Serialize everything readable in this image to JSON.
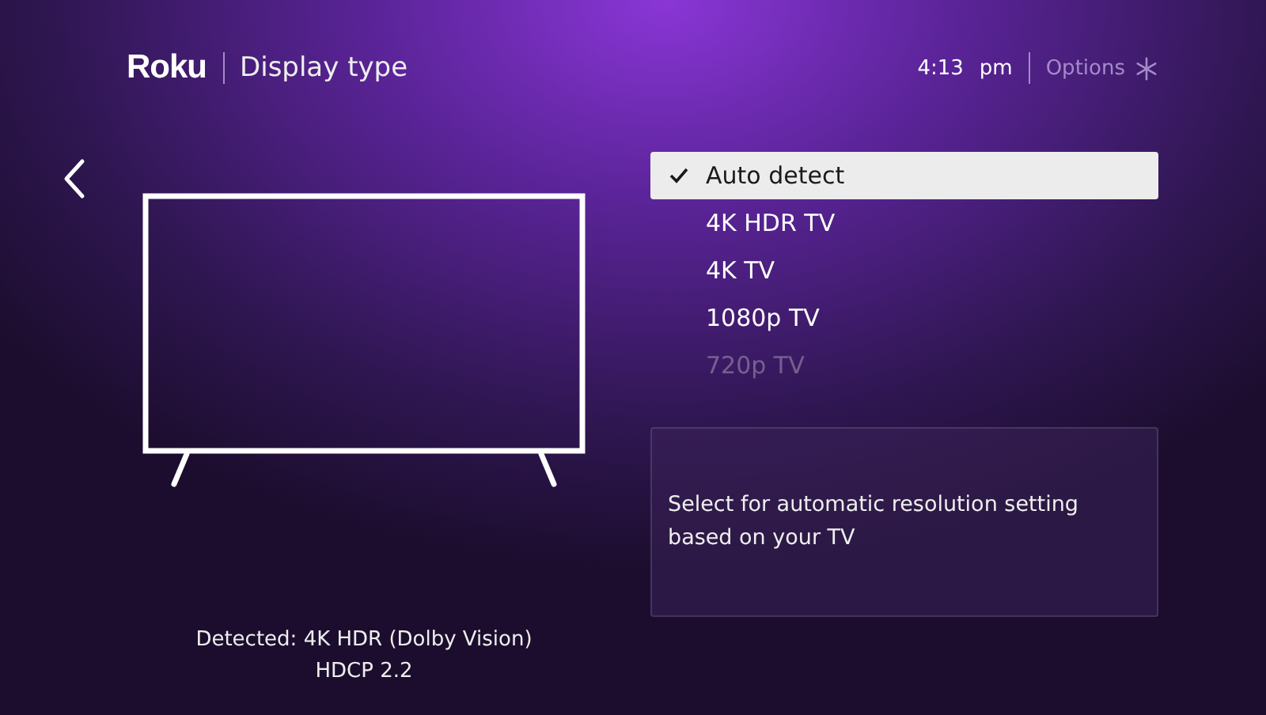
{
  "header": {
    "logo": "Roku",
    "title": "Display type",
    "time": "4:13",
    "ampm": "pm",
    "options": "Options"
  },
  "menu": [
    {
      "label": "Auto detect",
      "selected": true,
      "dimmed": false
    },
    {
      "label": "4K HDR TV",
      "selected": false,
      "dimmed": false
    },
    {
      "label": "4K TV",
      "selected": false,
      "dimmed": false
    },
    {
      "label": "1080p TV",
      "selected": false,
      "dimmed": false
    },
    {
      "label": "720p TV",
      "selected": false,
      "dimmed": true
    }
  ],
  "description": "Select for automatic resolution setting based on your TV",
  "detected": [
    "Detected: 4K HDR (Dolby Vision)",
    "HDCP 2.2"
  ]
}
